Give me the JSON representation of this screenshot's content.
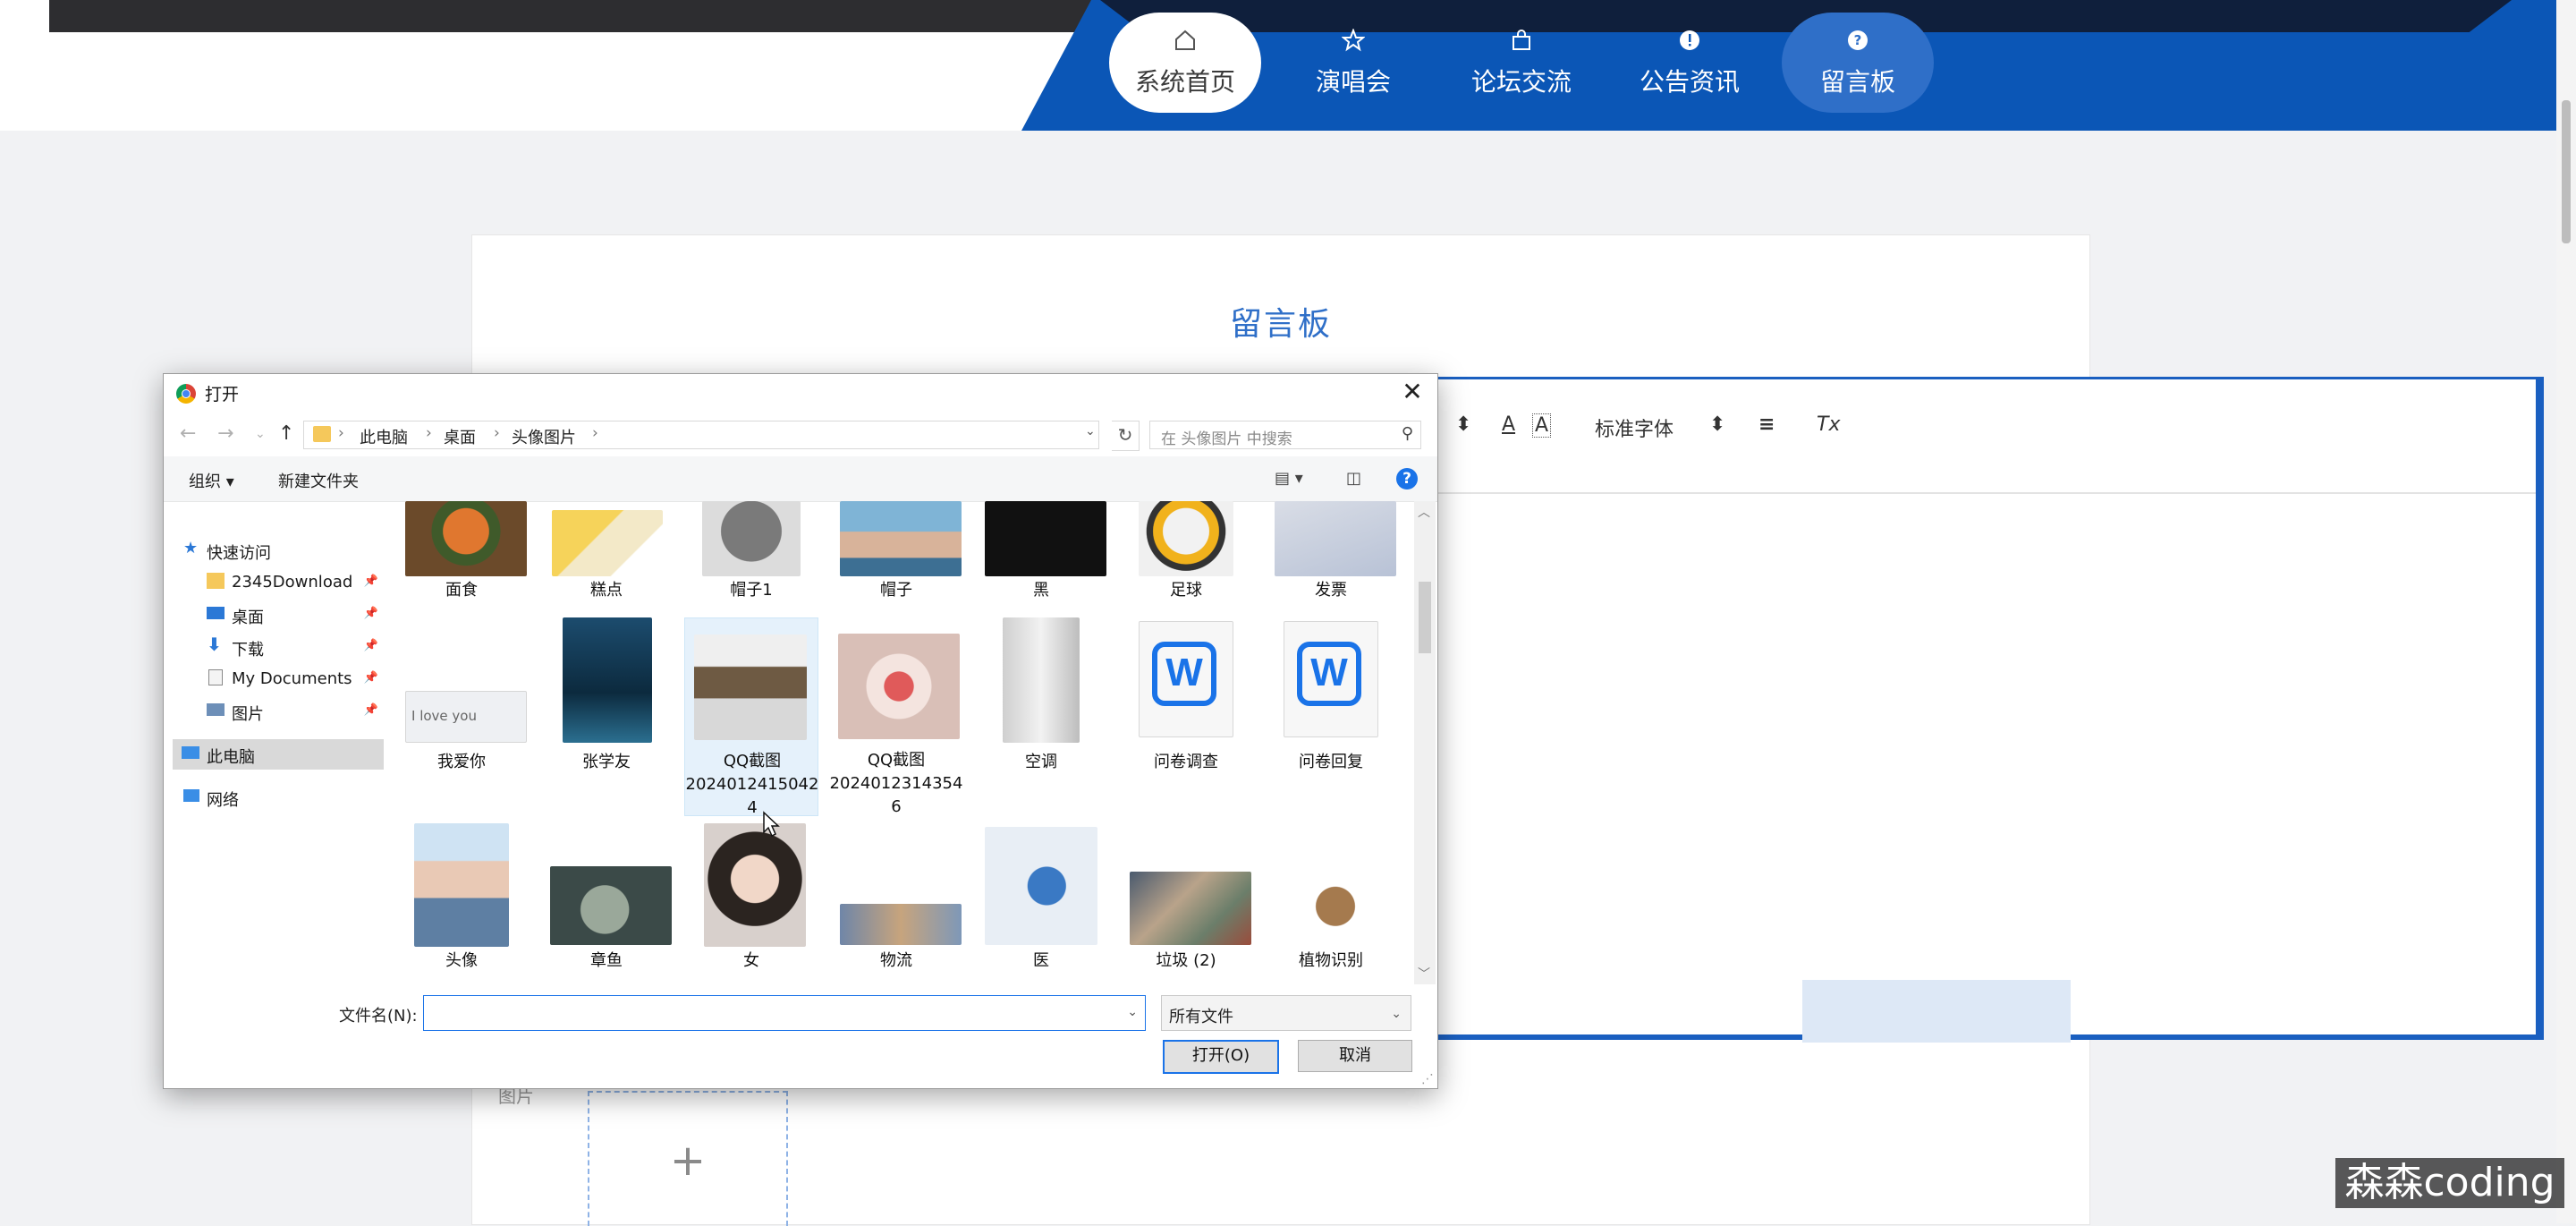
{
  "site": {
    "nav": [
      {
        "label": "系统首页",
        "icon": "home-icon"
      },
      {
        "label": "演唱会",
        "icon": "star-icon"
      },
      {
        "label": "论坛交流",
        "icon": "bag-icon"
      },
      {
        "label": "公告资讯",
        "icon": "alert-icon"
      },
      {
        "label": "留言板",
        "icon": "question-icon"
      }
    ],
    "colors": {
      "header_blue": "#0b56b6",
      "title_blue": "#2f6fc8"
    }
  },
  "board": {
    "title": "留言板",
    "image_label": "图片",
    "upload_plus": "+",
    "toolbar": {
      "size_glyph": "本",
      "font_color_glyph": "A",
      "bg_color_glyph": "A",
      "font_family": "标准字体",
      "align_glyph": "≡",
      "clear_glyph": "Tx"
    }
  },
  "dialog": {
    "title": "打开",
    "breadcrumb": [
      "此电脑",
      "桌面",
      "头像图片"
    ],
    "search_placeholder": "在 头像图片 中搜索",
    "commands": {
      "organize": "组织 ▾",
      "new_folder": "新建文件夹"
    },
    "nav_pane": [
      {
        "label": "快速访问",
        "icon": "star-icon",
        "pinned": false
      },
      {
        "label": "2345Download",
        "icon": "folder-icon",
        "pinned": true
      },
      {
        "label": "桌面",
        "icon": "desktop-icon",
        "pinned": true
      },
      {
        "label": "下载",
        "icon": "download-icon",
        "pinned": true
      },
      {
        "label": "My Documents",
        "icon": "document-icon",
        "pinned": true
      },
      {
        "label": "图片",
        "icon": "pictures-icon",
        "pinned": true
      },
      {
        "label": "此电脑",
        "icon": "computer-icon",
        "pinned": false
      },
      {
        "label": "网络",
        "icon": "network-icon",
        "pinned": false
      }
    ],
    "files": [
      {
        "name": "面食"
      },
      {
        "name": "糕点"
      },
      {
        "name": "帽子1"
      },
      {
        "name": "帽子"
      },
      {
        "name": "黑"
      },
      {
        "name": "足球"
      },
      {
        "name": "发票"
      },
      {
        "name": "我爱你",
        "caption": "I love you"
      },
      {
        "name": "张学友"
      },
      {
        "name": "QQ截图20240124150424",
        "lines": [
          "QQ截图",
          "2024012415042",
          "4"
        ]
      },
      {
        "name": "QQ截图20240123143546",
        "lines": [
          "QQ截图",
          "2024012314354",
          "6"
        ]
      },
      {
        "name": "空调"
      },
      {
        "name": "问卷调查"
      },
      {
        "name": "问卷回复"
      },
      {
        "name": "头像"
      },
      {
        "name": "章鱼"
      },
      {
        "name": "女"
      },
      {
        "name": "物流"
      },
      {
        "name": "医"
      },
      {
        "name": "垃圾 (2)"
      },
      {
        "name": "植物识别"
      }
    ],
    "filename_label": "文件名(N):",
    "filename_value": "",
    "filetype": "所有文件",
    "open_button": "打开(O)",
    "cancel_button": "取消"
  },
  "watermark": "森森coding"
}
